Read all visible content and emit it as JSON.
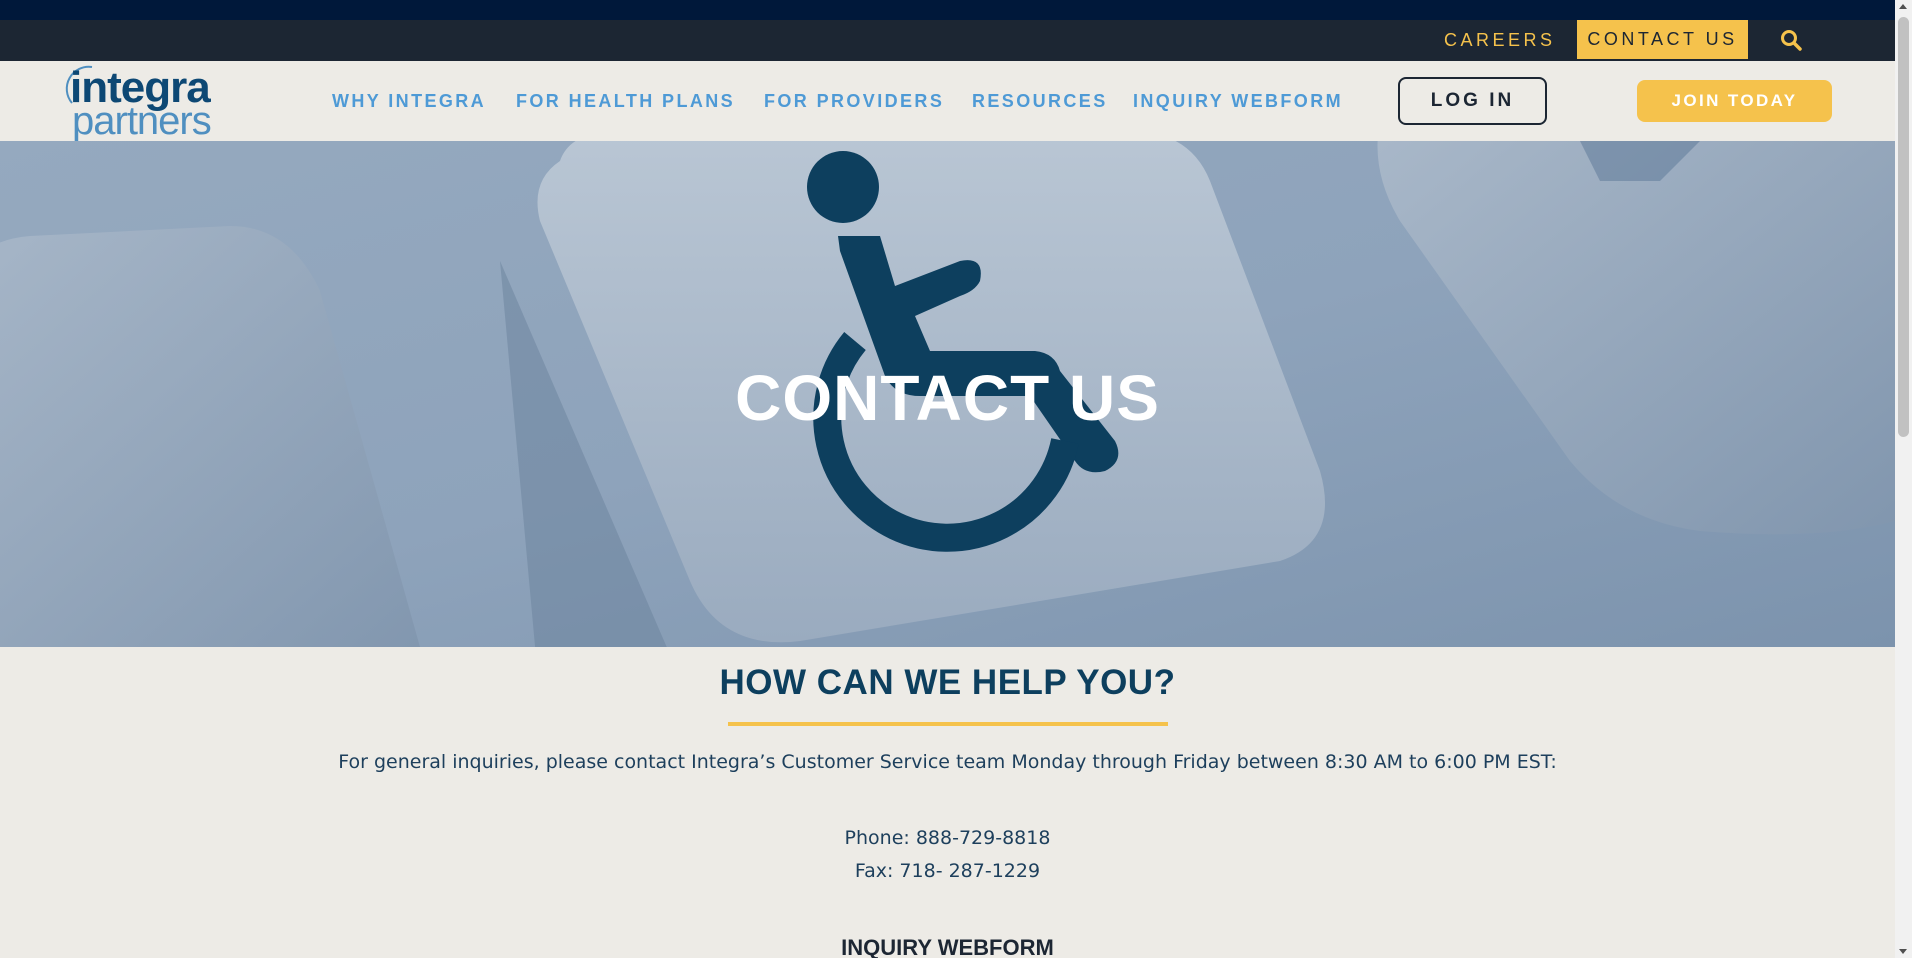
{
  "utility_nav": {
    "careers_label": "CAREERS",
    "contact_label": "CONTACT US",
    "search_icon": "search-icon"
  },
  "logo": {
    "line1": "integra",
    "line2": "partners"
  },
  "main_nav": {
    "items": [
      {
        "label": "WHY INTEGRA"
      },
      {
        "label": "FOR HEALTH PLANS"
      },
      {
        "label": "FOR PROVIDERS"
      },
      {
        "label": "RESOURCES"
      },
      {
        "label": "INQUIRY WEBFORM"
      }
    ],
    "login_label": "LOG IN",
    "join_label": "JOIN TODAY"
  },
  "hero": {
    "title": "CONTACT US",
    "image_icon": "wheelchair-icon"
  },
  "content": {
    "heading": "HOW CAN WE HELP YOU?",
    "intro": "For general inquiries, please contact Integra’s Customer Service team Monday through Friday between 8:30 AM to 6:00 PM EST:",
    "phone": "Phone: 888-729-8818",
    "fax": "Fax: 718- 287-1229",
    "webform_heading": "INQUIRY WEBFORM"
  },
  "colors": {
    "accent_yellow": "#f5c24c",
    "navy": "#1c2633",
    "dark_navy": "#00183a",
    "nav_blue": "#4e9ad6",
    "heading_blue": "#0d3f5e",
    "page_bg": "#edebe6"
  }
}
